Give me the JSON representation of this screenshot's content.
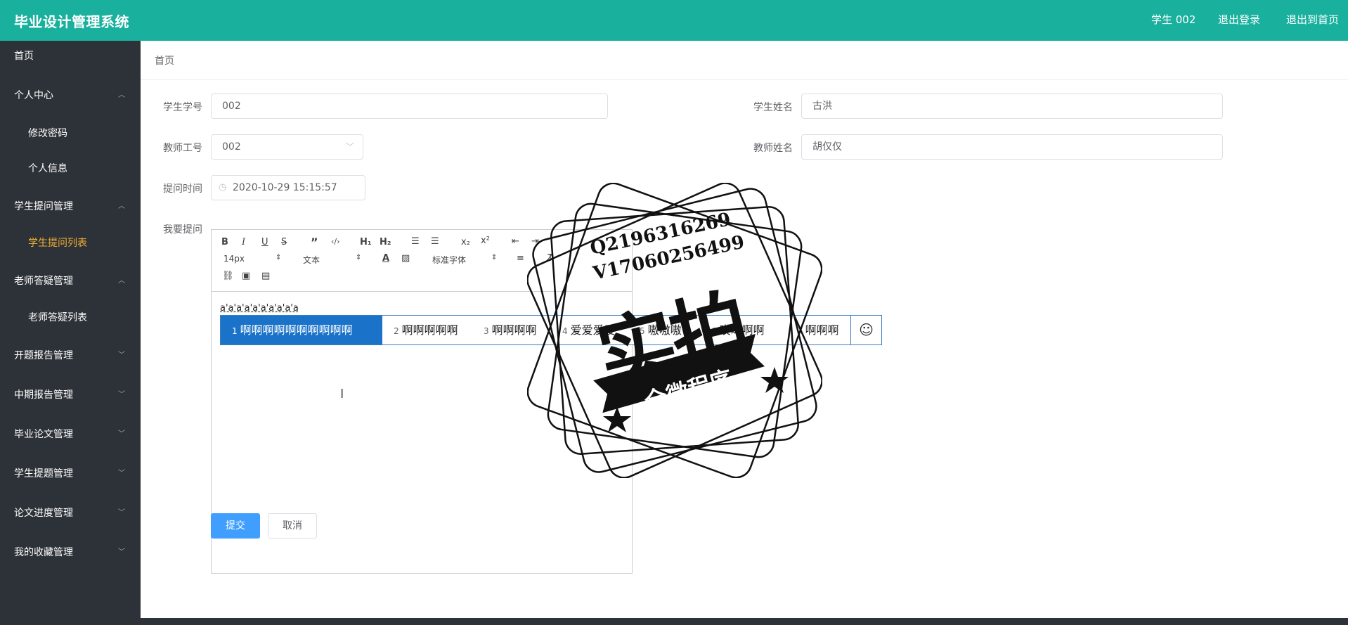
{
  "header": {
    "title": "毕业设计管理系统",
    "user": "学生 002",
    "logout": "退出登录",
    "to_home": "退出到首页"
  },
  "sidebar": {
    "items": [
      {
        "label": "首页"
      },
      {
        "label": "个人中心"
      },
      {
        "label": "修改密码"
      },
      {
        "label": "个人信息"
      },
      {
        "label": "学生提问管理"
      },
      {
        "label": "学生提问列表"
      },
      {
        "label": "老师答疑管理"
      },
      {
        "label": "老师答疑列表"
      },
      {
        "label": "开题报告管理"
      },
      {
        "label": "中期报告管理"
      },
      {
        "label": "毕业论文管理"
      },
      {
        "label": "学生提题管理"
      },
      {
        "label": "论文进度管理"
      },
      {
        "label": "我的收藏管理"
      }
    ]
  },
  "breadcrumb": "首页",
  "form": {
    "student_id_label": "学生学号",
    "student_id": "002",
    "student_name_label": "学生姓名",
    "student_name": "古洪",
    "teacher_id_label": "教师工号",
    "teacher_id": "002",
    "teacher_name_label": "教师姓名",
    "teacher_name": "胡仅仅",
    "time_label": "提问时间",
    "time": "2020-10-29 15:15:57",
    "question_label": "我要提问"
  },
  "editor": {
    "font_size": "14px",
    "block_type": "文本",
    "font_family": "标准字体",
    "content": "a'a'a'a'a'a'a'a'a'a"
  },
  "ime": {
    "candidates": [
      {
        "n": "1",
        "text": "啊啊啊啊啊啊啊啊啊啊"
      },
      {
        "n": "2",
        "text": "啊啊啊啊啊"
      },
      {
        "n": "3",
        "text": "啊啊啊啊"
      },
      {
        "n": "4",
        "text": "爱爱爱爱"
      },
      {
        "n": "5",
        "text": "嗷嗷嗷"
      },
      {
        "n": "6",
        "text": "哎呦啊啊"
      },
      {
        "n": "7",
        "text": "啊啊啊"
      }
    ],
    "emoji": "☺"
  },
  "buttons": {
    "submit": "提交",
    "cancel": "取消"
  },
  "watermark": {
    "line1": "Q2196316269",
    "line2": "V17060256499",
    "main": "实拍",
    "banner": "全微程序"
  }
}
